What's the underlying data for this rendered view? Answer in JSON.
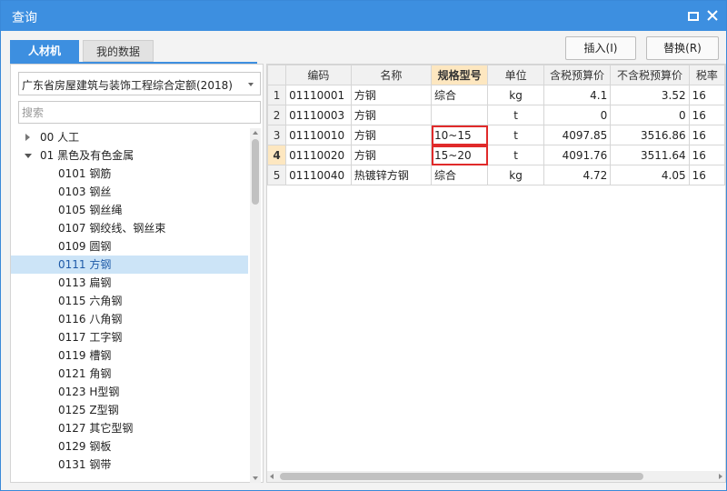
{
  "window": {
    "title": "查询"
  },
  "tabs": {
    "active": "人材机",
    "inactive": "我的数据"
  },
  "toolbar": {
    "insert_label": "插入(I)",
    "replace_label": "替换(R)"
  },
  "left": {
    "combo_value": "广东省房屋建筑与装饰工程综合定额(2018)",
    "search_placeholder": "搜索",
    "tree": [
      {
        "label": "00 人工",
        "level": 0,
        "expanded": false
      },
      {
        "label": "01 黑色及有色金属",
        "level": 0,
        "expanded": true
      },
      {
        "label": "0101 钢筋",
        "level": 1
      },
      {
        "label": "0103 钢丝",
        "level": 1
      },
      {
        "label": "0105 钢丝绳",
        "level": 1
      },
      {
        "label": "0107 钢绞线、钢丝束",
        "level": 1
      },
      {
        "label": "0109 圆钢",
        "level": 1
      },
      {
        "label": "0111 方钢",
        "level": 1,
        "selected": true
      },
      {
        "label": "0113 扁钢",
        "level": 1
      },
      {
        "label": "0115 六角钢",
        "level": 1
      },
      {
        "label": "0116 八角钢",
        "level": 1
      },
      {
        "label": "0117 工字钢",
        "level": 1
      },
      {
        "label": "0119 槽钢",
        "level": 1
      },
      {
        "label": "0121 角钢",
        "level": 1
      },
      {
        "label": "0123 H型钢",
        "level": 1
      },
      {
        "label": "0125 Z型钢",
        "level": 1
      },
      {
        "label": "0127 其它型钢",
        "level": 1
      },
      {
        "label": "0129 钢板",
        "level": 1
      },
      {
        "label": "0131 钢带",
        "level": 1
      }
    ]
  },
  "grid": {
    "headers": [
      "编码",
      "名称",
      "规格型号",
      "单位",
      "含税预算价",
      "不含税预算价",
      "税率"
    ],
    "highlight_header": 2,
    "rows": [
      {
        "num": "1",
        "code": "01110001",
        "name": "方钢",
        "spec": "综合",
        "unit": "kg",
        "tax_price": "4.1",
        "notax_price": "3.52",
        "rate": "16"
      },
      {
        "num": "2",
        "code": "01110003",
        "name": "方钢",
        "spec": "",
        "unit": "t",
        "tax_price": "0",
        "notax_price": "0",
        "rate": "16"
      },
      {
        "num": "3",
        "code": "01110010",
        "name": "方钢",
        "spec": "10~15",
        "unit": "t",
        "tax_price": "4097.85",
        "notax_price": "3516.86",
        "rate": "16"
      },
      {
        "num": "4",
        "code": "01110020",
        "name": "方钢",
        "spec": "15~20",
        "unit": "t",
        "tax_price": "4091.76",
        "notax_price": "3511.64",
        "rate": "16"
      },
      {
        "num": "5",
        "code": "01110040",
        "name": "热镀锌方钢",
        "spec": "综合",
        "unit": "kg",
        "tax_price": "4.72",
        "notax_price": "4.05",
        "rate": "16"
      }
    ],
    "current_row": 3,
    "highlighted_cells": [
      [
        2,
        "spec"
      ],
      [
        3,
        "spec"
      ]
    ]
  },
  "colors": {
    "accent": "#3d8fe0",
    "selected_bg": "#cce4f7",
    "header_highlight": "#fde7c0",
    "mark": "#e02a2a"
  }
}
